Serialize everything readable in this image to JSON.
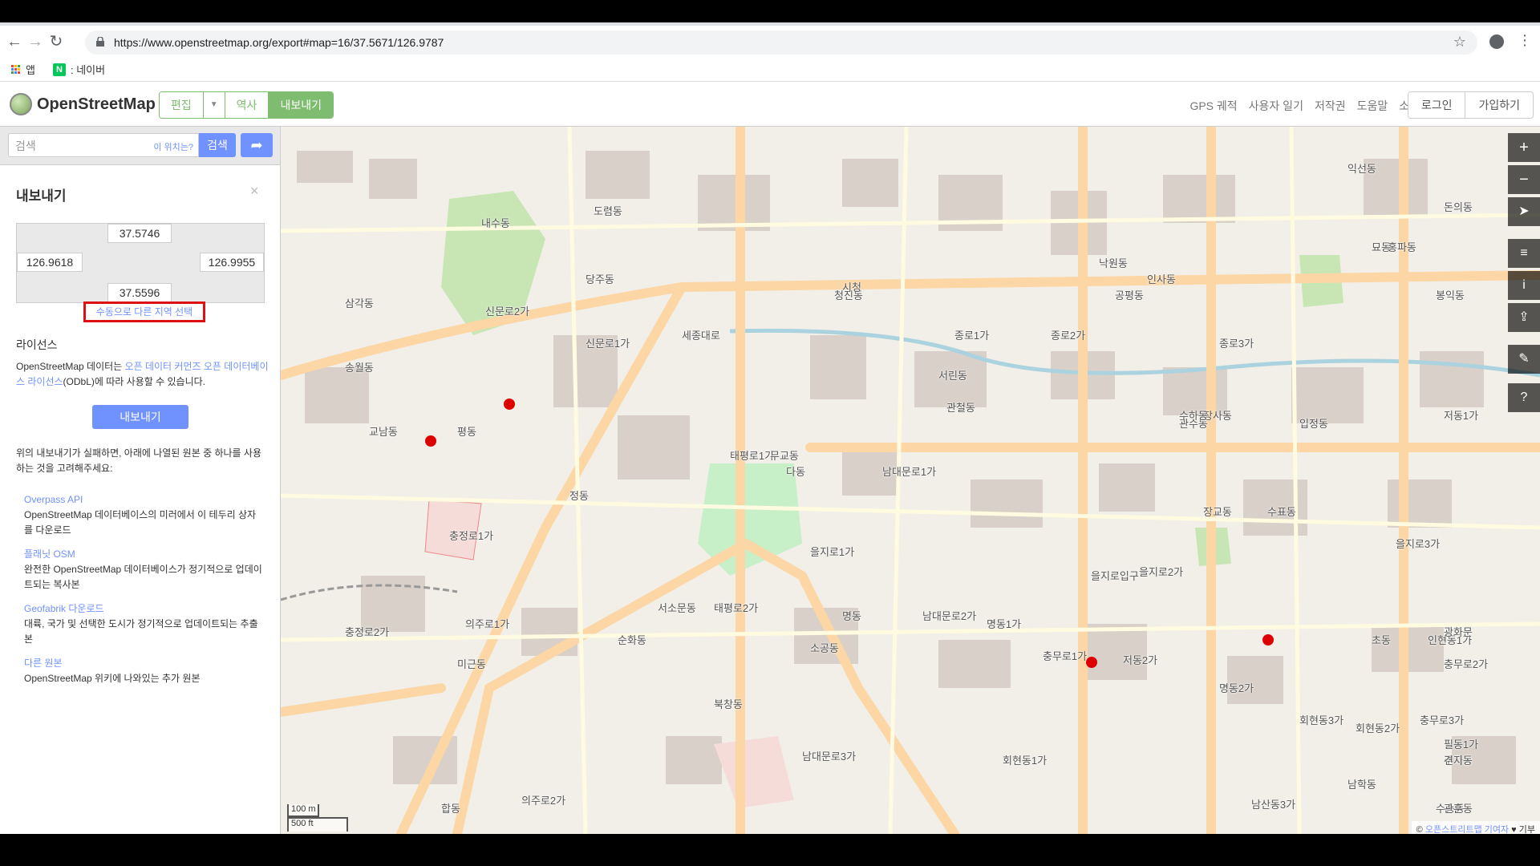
{
  "browser": {
    "url": "https://www.openstreetmap.org/export#map=16/37.5671/126.9787",
    "bookmarks": [
      {
        "label": "앱"
      },
      {
        "label": ": 네이버"
      }
    ]
  },
  "osm": {
    "logo": "OpenStreetMap",
    "edit": "편집",
    "history": "역사",
    "export": "내보내기",
    "nav": [
      "GPS 궤적",
      "사용자 일기",
      "저작권",
      "도움말",
      "소개"
    ],
    "login": "로그인",
    "signup": "가입하기"
  },
  "search": {
    "placeholder": "검색",
    "where": "이 위치는?",
    "button": "검색"
  },
  "panel": {
    "title": "내보내기",
    "coords": {
      "north": "37.5746",
      "west": "126.9618",
      "east": "126.9955",
      "south": "37.5596"
    },
    "manual_select": "수동으로 다른 지역 선택",
    "license_title": "라이선스",
    "license_pre": "OpenStreetMap 데이터는 ",
    "license_link1": "오픈 데이터 커먼즈 오픈 데이터베이스 라이선스",
    "license_post": "(ODbL)에 따라 사용할 수 있습니다.",
    "export_button": "내보내기",
    "fallback": "위의 내보내기가 실패하면, 아래에 나열된 원본 중 하나를 사용하는 것을 고려해주세요:",
    "sources": [
      {
        "title": "Overpass API",
        "desc": "OpenStreetMap 데이터베이스의 미러에서 이 테두리 상자를 다운로드"
      },
      {
        "title": "플래닛 OSM",
        "desc": "완전한 OpenStreetMap 데이터베이스가 정기적으로 업데이트되는 복사본"
      },
      {
        "title": "Geofabrik 다운로드",
        "desc": "대륙, 국가 및 선택한 도시가 정기적으로 업데이트되는 추출본"
      },
      {
        "title": "다른 원본",
        "desc": "OpenStreetMap 위키에 나와있는 추가 원본"
      }
    ]
  },
  "map": {
    "scale_m": "100 m",
    "scale_ft": "500 ft",
    "attribution_prefix": "© ",
    "attribution_link": "오픈스트리트맵 기여자",
    "attribution_suffix": " ♥ 기부",
    "labels": [
      "신문로2가",
      "신문로1가",
      "세종대로",
      "청진동",
      "종로1가",
      "서린동",
      "관철동",
      "태평로1가",
      "무교동",
      "다동",
      "남대문로1가",
      "정동",
      "태평로2가",
      "을지로1가",
      "을지로2가",
      "남대문로2가",
      "명동1가",
      "명동2가",
      "소공동",
      "북창동",
      "남대문로3가",
      "회현동1가",
      "충무로1가",
      "저동2가",
      "수표동",
      "장교동",
      "관수동",
      "인사동",
      "낙원동",
      "공평동",
      "도렴동",
      "당주동",
      "내수동",
      "송월동",
      "교남동",
      "평동",
      "충정로1가",
      "순화동",
      "서소문동",
      "의주로1가",
      "의주로2가",
      "합동",
      "미근동",
      "충정로2가",
      "종로2가",
      "종로3가",
      "장사동",
      "입정동",
      "을지로3가",
      "초동",
      "인현동1가",
      "충무로2가",
      "충무로3가",
      "필동1가",
      "주자동",
      "남학동",
      "남산동3가",
      "회현동3가",
      "회현동2가",
      "수송동",
      "견지동",
      "관훈동",
      "익선동",
      "돈의동",
      "묘동",
      "봉익동",
      "홍파동",
      "삼각동",
      "수하동",
      "저동1가",
      "광화문",
      "시청",
      "을지로입구",
      "명동"
    ]
  },
  "colors": {
    "osm_green": "#7ebc6f",
    "osm_blue": "#7092ff",
    "highlight_red": "#dd1111"
  }
}
